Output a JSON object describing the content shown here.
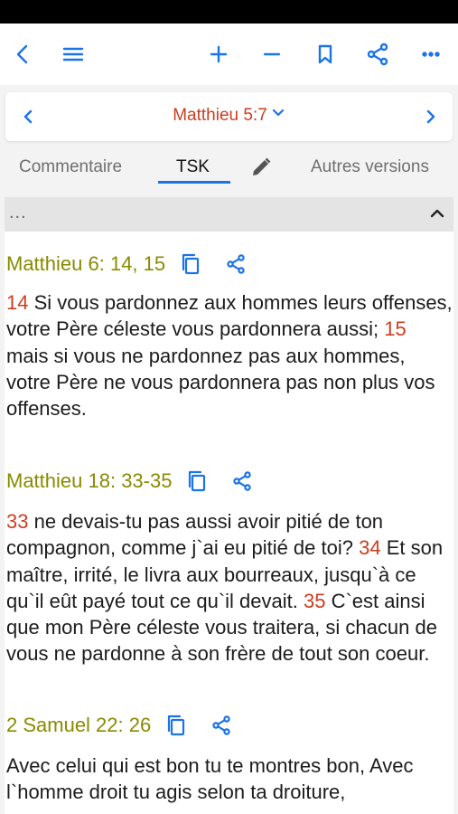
{
  "toolbar": {
    "icons": [
      "back-icon",
      "menu-icon",
      "zoom-in-icon",
      "zoom-out-icon",
      "bookmark-icon",
      "share-icon",
      "more-icon"
    ]
  },
  "navigation": {
    "reference": "Matthieu 5:7"
  },
  "tabs": {
    "commentary": "Commentaire",
    "tsk": "TSK",
    "other_versions": "Autres versions"
  },
  "collapse_bar": {
    "label": "..."
  },
  "references": [
    {
      "ref": "Matthieu 6: 14, 15",
      "segments": [
        {
          "num": "14",
          "text": " Si vous pardonnez aux hommes leurs offenses, votre Père céleste vous pardonnera aussi; "
        },
        {
          "num": "15",
          "text": " mais si vous ne pardonnez pas aux hommes, votre Père ne vous pardonnera pas non plus vos offenses."
        }
      ]
    },
    {
      "ref": "Matthieu 18: 33-35",
      "segments": [
        {
          "num": "33",
          "text": " ne devais-tu pas aussi avoir pitié de ton compagnon, comme j`ai eu pitié de toi? "
        },
        {
          "num": "34",
          "text": " Et son maître, irrité, le livra aux bourreaux, jusqu`à ce qu`il eût payé tout ce qu`il devait. "
        },
        {
          "num": "35",
          "text": " C`est ainsi que mon Père céleste vous traitera, si chacun de vous ne pardonne à son frère de tout son coeur."
        }
      ]
    },
    {
      "ref": "2 Samuel 22: 26",
      "segments": [
        {
          "num": "",
          "text": "Avec celui qui est bon tu te montres bon, Avec l`homme droit tu agis selon ta droiture,"
        }
      ]
    }
  ],
  "colors": {
    "accent": "#1a73e8",
    "verse_number": "#cc3d1f",
    "reference": "#8a8a00"
  }
}
